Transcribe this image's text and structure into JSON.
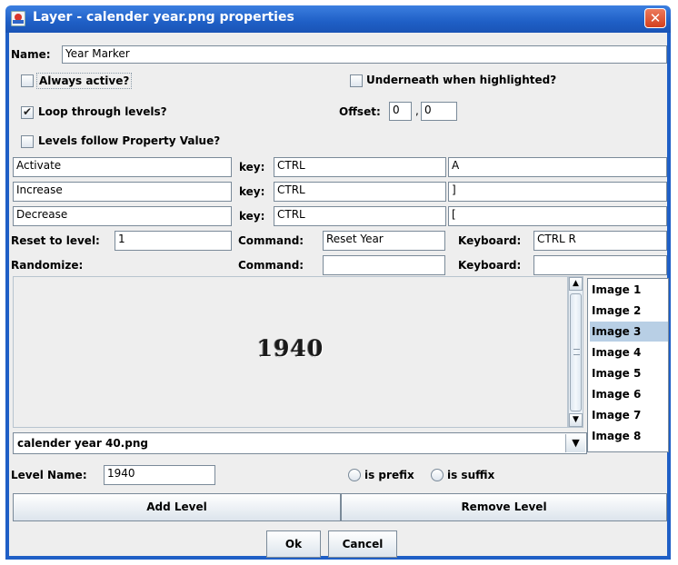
{
  "window": {
    "title": "Layer - calender year.png properties",
    "close_glyph": "✕"
  },
  "name": {
    "label": "Name:",
    "value": "Year Marker"
  },
  "options": {
    "always_active": {
      "label": "Always active?",
      "checked": false
    },
    "underneath": {
      "label": "Underneath when highlighted?",
      "checked": false
    },
    "loop_levels": {
      "label": "Loop through levels?",
      "checked": true
    },
    "offset": {
      "label": "Offset:",
      "x": "0",
      "comma": ",",
      "y": "0"
    },
    "levels_follow": {
      "label": "Levels follow Property Value?",
      "checked": false
    }
  },
  "key_rows": [
    {
      "action": "Activate",
      "key_label": "key:",
      "modifier": "CTRL",
      "key": "A"
    },
    {
      "action": "Increase",
      "key_label": "key:",
      "modifier": "CTRL",
      "key": "]"
    },
    {
      "action": "Decrease",
      "key_label": "key:",
      "modifier": "CTRL",
      "key": "["
    }
  ],
  "reset": {
    "label": "Reset to level:",
    "value": "1",
    "command_label": "Command:",
    "command": "Reset Year",
    "keyboard_label": "Keyboard:",
    "keyboard": "CTRL R"
  },
  "randomize": {
    "label": "Randomize:",
    "command_label": "Command:",
    "command": "",
    "keyboard_label": "Keyboard:",
    "keyboard": ""
  },
  "preview": {
    "text": "1940"
  },
  "images": {
    "items": [
      "Image 1",
      "Image 2",
      "Image 3",
      "Image 4",
      "Image 5",
      "Image 6",
      "Image 7",
      "Image 8"
    ],
    "selected_index": 2
  },
  "file_combo": {
    "value": "calender year 40.png"
  },
  "level_name": {
    "label": "Level Name:",
    "value": "1940",
    "prefix_label": "is prefix",
    "suffix_label": "is suffix"
  },
  "buttons": {
    "add": "Add Level",
    "remove": "Remove Level",
    "ok": "Ok",
    "cancel": "Cancel"
  },
  "colors": {
    "titlebar": "#1f5fc6",
    "selection": "#b8cfe5",
    "close": "#d4401e"
  }
}
